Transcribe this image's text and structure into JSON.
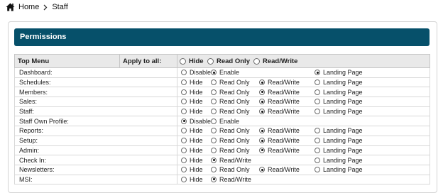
{
  "breadcrumb": {
    "home": "Home",
    "current": "Staff"
  },
  "panel": {
    "title": "Permissions"
  },
  "table": {
    "col_top_menu": "Top Menu",
    "col_apply": "Apply to all:",
    "apply_options": [
      "Hide",
      "Read Only",
      "Read/Write"
    ],
    "rows": [
      {
        "label": "Dashboard:",
        "options": [
          {
            "slot": 1,
            "text": "Disable",
            "checked": false
          },
          {
            "slot": 2,
            "text": "Enable",
            "checked": true
          },
          {
            "slot": 4,
            "text": "Landing Page",
            "checked": true
          }
        ]
      },
      {
        "label": "Schedules:",
        "options": [
          {
            "slot": 1,
            "text": "Hide",
            "checked": false
          },
          {
            "slot": 2,
            "text": "Read Only",
            "checked": false
          },
          {
            "slot": 3,
            "text": "Read/Write",
            "checked": true
          },
          {
            "slot": 4,
            "text": "Landing Page",
            "checked": false
          }
        ]
      },
      {
        "label": "Members:",
        "options": [
          {
            "slot": 1,
            "text": "Hide",
            "checked": false
          },
          {
            "slot": 2,
            "text": "Read Only",
            "checked": false
          },
          {
            "slot": 3,
            "text": "Read/Write",
            "checked": true
          },
          {
            "slot": 4,
            "text": "Landing Page",
            "checked": false
          }
        ]
      },
      {
        "label": "Sales:",
        "options": [
          {
            "slot": 1,
            "text": "Hide",
            "checked": false
          },
          {
            "slot": 2,
            "text": "Read Only",
            "checked": false
          },
          {
            "slot": 3,
            "text": "Read/Write",
            "checked": true
          },
          {
            "slot": 4,
            "text": "Landing Page",
            "checked": false
          }
        ]
      },
      {
        "label": "Staff:",
        "options": [
          {
            "slot": 1,
            "text": "Hide",
            "checked": false
          },
          {
            "slot": 2,
            "text": "Read Only",
            "checked": false
          },
          {
            "slot": 3,
            "text": "Read/Write",
            "checked": true
          },
          {
            "slot": 4,
            "text": "Landing Page",
            "checked": false
          }
        ]
      },
      {
        "label": "Staff Own Profile:",
        "options": [
          {
            "slot": 1,
            "text": "Disable",
            "checked": true
          },
          {
            "slot": 2,
            "text": "Enable",
            "checked": false
          }
        ]
      },
      {
        "label": "Reports:",
        "options": [
          {
            "slot": 1,
            "text": "Hide",
            "checked": false
          },
          {
            "slot": 2,
            "text": "Read Only",
            "checked": false
          },
          {
            "slot": 3,
            "text": "Read/Write",
            "checked": true
          },
          {
            "slot": 4,
            "text": "Landing Page",
            "checked": false
          }
        ]
      },
      {
        "label": "Setup:",
        "options": [
          {
            "slot": 1,
            "text": "Hide",
            "checked": false
          },
          {
            "slot": 2,
            "text": "Read Only",
            "checked": false
          },
          {
            "slot": 3,
            "text": "Read/Write",
            "checked": true
          },
          {
            "slot": 4,
            "text": "Landing Page",
            "checked": false
          }
        ]
      },
      {
        "label": "Admin:",
        "options": [
          {
            "slot": 1,
            "text": "Hide",
            "checked": false
          },
          {
            "slot": 2,
            "text": "Read Only",
            "checked": false
          },
          {
            "slot": 3,
            "text": "Read/Write",
            "checked": true
          },
          {
            "slot": 4,
            "text": "Landing Page",
            "checked": false
          }
        ]
      },
      {
        "label": "Check In:",
        "options": [
          {
            "slot": 1,
            "text": "Hide",
            "checked": false
          },
          {
            "slot": 2,
            "text": "Read/Write",
            "checked": true
          },
          {
            "slot": 4,
            "text": "Landing Page",
            "checked": false
          }
        ]
      },
      {
        "label": "Newsletters:",
        "options": [
          {
            "slot": 1,
            "text": "Hide",
            "checked": false
          },
          {
            "slot": 2,
            "text": "Read Only",
            "checked": false
          },
          {
            "slot": 3,
            "text": "Read/Write",
            "checked": true
          },
          {
            "slot": 4,
            "text": "Landing Page",
            "checked": false
          }
        ]
      },
      {
        "label": "MSI:",
        "options": [
          {
            "slot": 1,
            "text": "Hide",
            "checked": false
          },
          {
            "slot": 2,
            "text": "Read/Write",
            "checked": true
          }
        ]
      }
    ]
  },
  "colors": {
    "header_bg": "#06506a",
    "header_text": "#ffffff",
    "table_header_bg": "#e9e9e9"
  }
}
